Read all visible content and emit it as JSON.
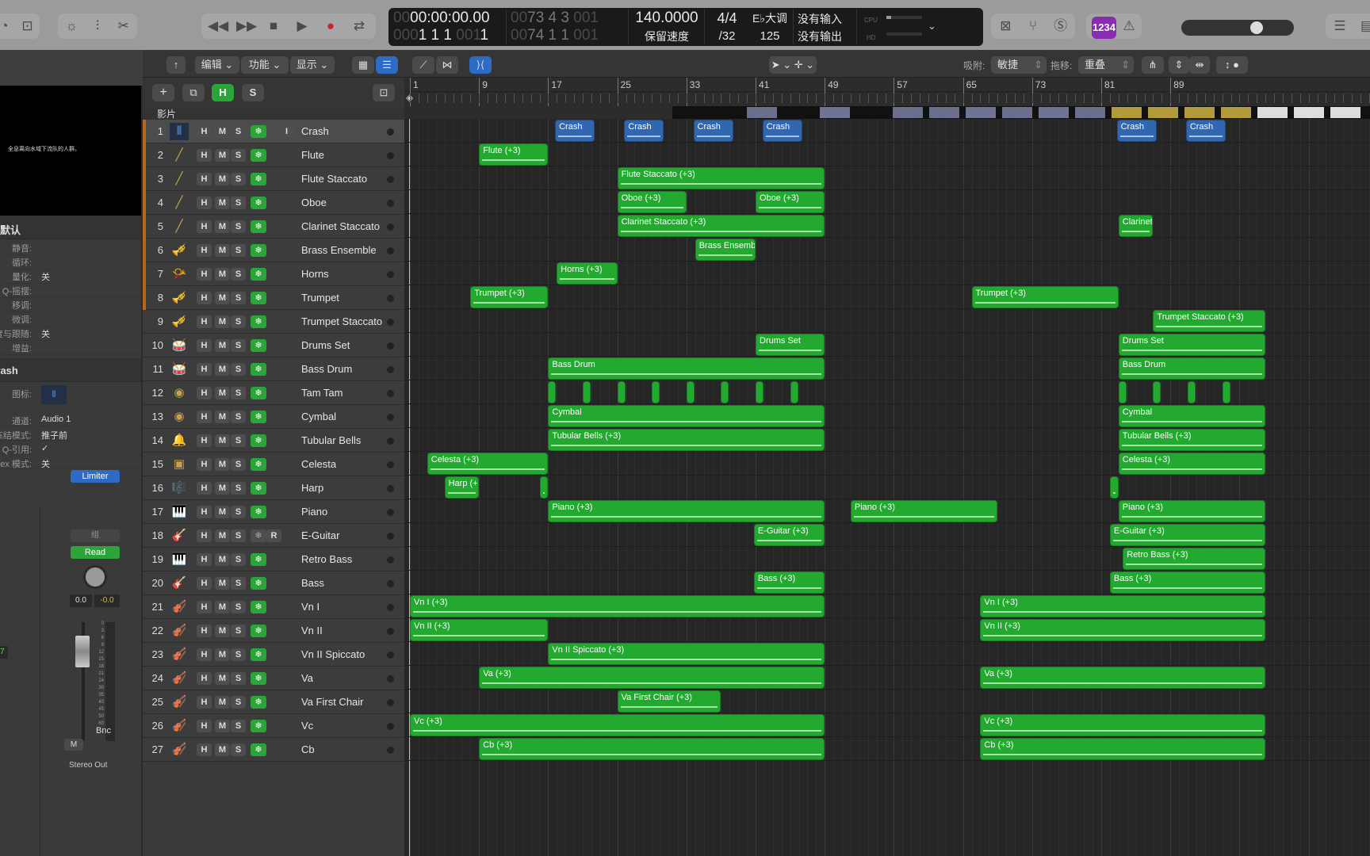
{
  "transport": {
    "time": "00:00:00.00",
    "time_prefix": "00",
    "position_bars": "1 1 1",
    "position_prefix": "000",
    "position_ticks_dim": "001",
    "position_end_dim": "1",
    "cycle_start": "73  4  3",
    "cycle_start_prefix": "00",
    "cycle_start_ticks": "001",
    "cycle_end": "74  1  1",
    "cycle_end_prefix": "00",
    "cycle_end_ticks": "001",
    "tempo": "140.0000",
    "tempo_mode": "保留速度",
    "signature": "4/4",
    "division": "/32",
    "key": "E♭大调",
    "key_extra": "125",
    "input": "没有输入",
    "output": "没有输出",
    "cpu_label": "CPU",
    "hd_label": "HD",
    "count_in_label": "1234"
  },
  "toolbar2": {
    "edit": "编辑",
    "functions": "功能",
    "view": "显示",
    "snap_label": "吸附:",
    "snap_value": "敏捷",
    "drag_label": "拖移:",
    "drag_value": "重叠"
  },
  "track_header": {
    "h_label": "H",
    "s_label": "S",
    "movie_label": "影片"
  },
  "inspector": {
    "video_caption": "全息离向水域下流队的人群。",
    "region_header": "默认",
    "rows": [
      {
        "label": "静音:",
        "value": ""
      },
      {
        "label": "循环:",
        "value": ""
      },
      {
        "label": "量化:",
        "value": "关"
      },
      {
        "label": "Q-摇摆:",
        "value": ""
      },
      {
        "label": "移调:",
        "value": ""
      },
      {
        "label": "微调:",
        "value": ""
      },
      {
        "label": "力度与跟随:",
        "value": "关"
      },
      {
        "label": "增益:",
        "value": ""
      }
    ],
    "track_header": "Crash",
    "track_rows": [
      {
        "label": "图标:",
        "value": ""
      },
      {
        "label": "通道:",
        "value": "Audio 1"
      },
      {
        "label": "冻结模式:",
        "value": "推子前"
      },
      {
        "label": "Q-引用:",
        "value": "✓"
      },
      {
        "label": "Flex 模式:",
        "value": "关"
      }
    ],
    "plugin": "Limiter",
    "group": "组",
    "automation": "Read",
    "volume": "0.0",
    "pan_peak": "-0.0",
    "left_value": "7",
    "bounce": "Bnc",
    "mute": "M",
    "output": "Stereo Out",
    "meter_scale": [
      "0",
      "3",
      "6",
      "9",
      "12",
      "15",
      "18",
      "21",
      "24",
      "30",
      "35",
      "40",
      "45",
      "50",
      "60"
    ]
  },
  "ruler": {
    "bars": [
      "1",
      "9",
      "17",
      "25",
      "33",
      "41",
      "49",
      "57",
      "65",
      "73",
      "81",
      "89"
    ]
  },
  "tracks": [
    {
      "num": "1",
      "name": "Crash",
      "icon": "audio-waveform",
      "sel": true,
      "input": "I"
    },
    {
      "num": "2",
      "name": "Flute",
      "icon": "flute"
    },
    {
      "num": "3",
      "name": "Flute Staccato",
      "icon": "flute"
    },
    {
      "num": "4",
      "name": "Oboe",
      "icon": "oboe"
    },
    {
      "num": "5",
      "name": "Clarinet Staccato",
      "icon": "clarinet"
    },
    {
      "num": "6",
      "name": "Brass Ensemble",
      "icon": "brass"
    },
    {
      "num": "7",
      "name": "Horns",
      "icon": "horn"
    },
    {
      "num": "8",
      "name": "Trumpet",
      "icon": "trumpet"
    },
    {
      "num": "9",
      "name": "Trumpet Staccato",
      "icon": "trumpet"
    },
    {
      "num": "10",
      "name": "Drums Set",
      "icon": "drums"
    },
    {
      "num": "11",
      "name": "Bass Drum",
      "icon": "bass-drum"
    },
    {
      "num": "12",
      "name": "Tam Tam",
      "icon": "gong"
    },
    {
      "num": "13",
      "name": "Cymbal",
      "icon": "cymbal"
    },
    {
      "num": "14",
      "name": "Tubular Bells",
      "icon": "bells"
    },
    {
      "num": "15",
      "name": "Celesta",
      "icon": "celesta"
    },
    {
      "num": "16",
      "name": "Harp",
      "icon": "harp"
    },
    {
      "num": "17",
      "name": "Piano",
      "icon": "piano"
    },
    {
      "num": "18",
      "name": "E-Guitar",
      "icon": "guitar",
      "record": "R",
      "frozen": false
    },
    {
      "num": "19",
      "name": "Retro Bass",
      "icon": "synth"
    },
    {
      "num": "20",
      "name": "Bass",
      "icon": "bass-guitar"
    },
    {
      "num": "21",
      "name": "Vn I",
      "icon": "violin"
    },
    {
      "num": "22",
      "name": "Vn II",
      "icon": "violin"
    },
    {
      "num": "23",
      "name": "Vn II Spiccato",
      "icon": "violin"
    },
    {
      "num": "24",
      "name": "Va",
      "icon": "viola"
    },
    {
      "num": "25",
      "name": "Va First Chair",
      "icon": "viola"
    },
    {
      "num": "26",
      "name": "Vc",
      "icon": "cello"
    },
    {
      "num": "27",
      "name": "Cb",
      "icon": "contrabass"
    }
  ],
  "regions": [
    {
      "track": 0,
      "start": 17.8,
      "end": 22.4,
      "label": "Crash",
      "type": "audio"
    },
    {
      "track": 0,
      "start": 25.8,
      "end": 30.4,
      "label": "Crash",
      "type": "audio"
    },
    {
      "track": 0,
      "start": 33.8,
      "end": 38.4,
      "label": "Crash",
      "type": "audio"
    },
    {
      "track": 0,
      "start": 41.8,
      "end": 46.4,
      "label": "Crash",
      "type": "audio"
    },
    {
      "track": 0,
      "start": 82.8,
      "end": 87.4,
      "label": "Crash",
      "type": "audio"
    },
    {
      "track": 0,
      "start": 90.8,
      "end": 95.4,
      "label": "Crash",
      "type": "audio"
    },
    {
      "track": 1,
      "start": 9,
      "end": 17,
      "label": "Flute (+3)"
    },
    {
      "track": 2,
      "start": 25,
      "end": 49,
      "label": "Flute Staccato (+3)"
    },
    {
      "track": 3,
      "start": 25,
      "end": 33,
      "label": "Oboe (+3)"
    },
    {
      "track": 3,
      "start": 41,
      "end": 49,
      "label": "Oboe (+3)"
    },
    {
      "track": 4,
      "start": 25,
      "end": 49,
      "label": "Clarinet Staccato (+3)"
    },
    {
      "track": 4,
      "start": 83,
      "end": 87,
      "label": "Clarinet"
    },
    {
      "track": 5,
      "start": 34,
      "end": 41,
      "label": "Brass Ensembl"
    },
    {
      "track": 6,
      "start": 18,
      "end": 25,
      "label": "Horns (+3)"
    },
    {
      "track": 7,
      "start": 8,
      "end": 17,
      "label": "Trumpet (+3)"
    },
    {
      "track": 7,
      "start": 66,
      "end": 83,
      "label": "Trumpet (+3)"
    },
    {
      "track": 8,
      "start": 87,
      "end": 100,
      "label": "Trumpet Staccato (+3)"
    },
    {
      "track": 9,
      "start": 41,
      "end": 49,
      "label": "Drums Set"
    },
    {
      "track": 9,
      "start": 83,
      "end": 100,
      "label": "Drums Set"
    },
    {
      "track": 10,
      "start": 17,
      "end": 49,
      "label": "Bass Drum"
    },
    {
      "track": 10,
      "start": 83,
      "end": 100,
      "label": "Bass Drum"
    },
    {
      "track": 12,
      "start": 17,
      "end": 49,
      "label": "Cymbal"
    },
    {
      "track": 12,
      "start": 83,
      "end": 100,
      "label": "Cymbal"
    },
    {
      "track": 13,
      "start": 17,
      "end": 49,
      "label": "Tubular Bells (+3)"
    },
    {
      "track": 13,
      "start": 83,
      "end": 100,
      "label": "Tubular Bells (+3)"
    },
    {
      "track": 14,
      "start": 3,
      "end": 17,
      "label": "Celesta (+3)"
    },
    {
      "track": 14,
      "start": 83,
      "end": 100,
      "label": "Celesta (+3)"
    },
    {
      "track": 15,
      "start": 5,
      "end": 9,
      "label": "Harp (+"
    },
    {
      "track": 15,
      "start": 16,
      "end": 17,
      "label": ""
    },
    {
      "track": 15,
      "start": 82,
      "end": 83,
      "label": ""
    },
    {
      "track": 16,
      "start": 17,
      "end": 49,
      "label": "Piano (+3)"
    },
    {
      "track": 16,
      "start": 52,
      "end": 69,
      "label": "Piano (+3)"
    },
    {
      "track": 16,
      "start": 83,
      "end": 100,
      "label": "Piano (+3)"
    },
    {
      "track": 17,
      "start": 40.8,
      "end": 49,
      "label": "E-Guitar (+3)"
    },
    {
      "track": 17,
      "start": 82,
      "end": 100,
      "label": "E-Guitar (+3)"
    },
    {
      "track": 18,
      "start": 83.5,
      "end": 100,
      "label": "Retro Bass (+3)"
    },
    {
      "track": 19,
      "start": 40.8,
      "end": 49,
      "label": "Bass (+3)"
    },
    {
      "track": 19,
      "start": 82,
      "end": 100,
      "label": "Bass (+3)"
    },
    {
      "track": 20,
      "start": 1,
      "end": 49,
      "label": "Vn I (+3)"
    },
    {
      "track": 20,
      "start": 67,
      "end": 100,
      "label": "Vn I (+3)"
    },
    {
      "track": 21,
      "start": 1,
      "end": 17,
      "label": "Vn II (+3)"
    },
    {
      "track": 21,
      "start": 67,
      "end": 100,
      "label": "Vn II (+3)"
    },
    {
      "track": 22,
      "start": 17,
      "end": 49,
      "label": "Vn II Spiccato (+3)"
    },
    {
      "track": 23,
      "start": 9,
      "end": 49,
      "label": "Va (+3)"
    },
    {
      "track": 23,
      "start": 67,
      "end": 100,
      "label": "Va (+3)"
    },
    {
      "track": 24,
      "start": 25,
      "end": 37,
      "label": "Va First Chair (+3)"
    },
    {
      "track": 25,
      "start": 1,
      "end": 49,
      "label": "Vc (+3)"
    },
    {
      "track": 25,
      "start": 67,
      "end": 100,
      "label": "Vc (+3)"
    },
    {
      "track": 26,
      "start": 9,
      "end": 49,
      "label": "Cb (+3)"
    },
    {
      "track": 26,
      "start": 67,
      "end": 100,
      "label": "Cb (+3)"
    }
  ],
  "tamtam_hits": [
    17,
    21,
    25,
    29,
    33,
    37,
    41,
    45,
    83,
    87,
    91,
    95
  ]
}
